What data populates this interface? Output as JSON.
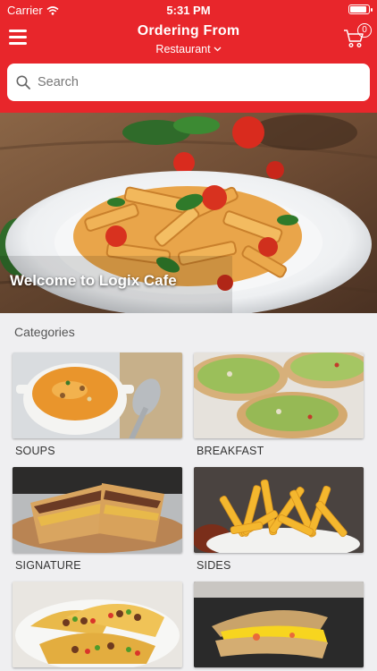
{
  "status_bar": {
    "carrier": "Carrier",
    "time": "5:31 PM"
  },
  "header": {
    "title": "Ordering From",
    "subtitle": "Restaurant",
    "cart_count": "0",
    "brand_color": "#e8262b"
  },
  "search": {
    "placeholder": "Search",
    "value": ""
  },
  "hero": {
    "title": "Welcome to Logix Cafe"
  },
  "categories": {
    "heading": "Categories",
    "items": [
      {
        "label": "SOUPS"
      },
      {
        "label": "BREAKFAST"
      },
      {
        "label": "SIGNATURE"
      },
      {
        "label": "SIDES"
      },
      {
        "label": "",
        "image": "tacos"
      },
      {
        "label": "",
        "image": "quesadilla"
      }
    ]
  }
}
